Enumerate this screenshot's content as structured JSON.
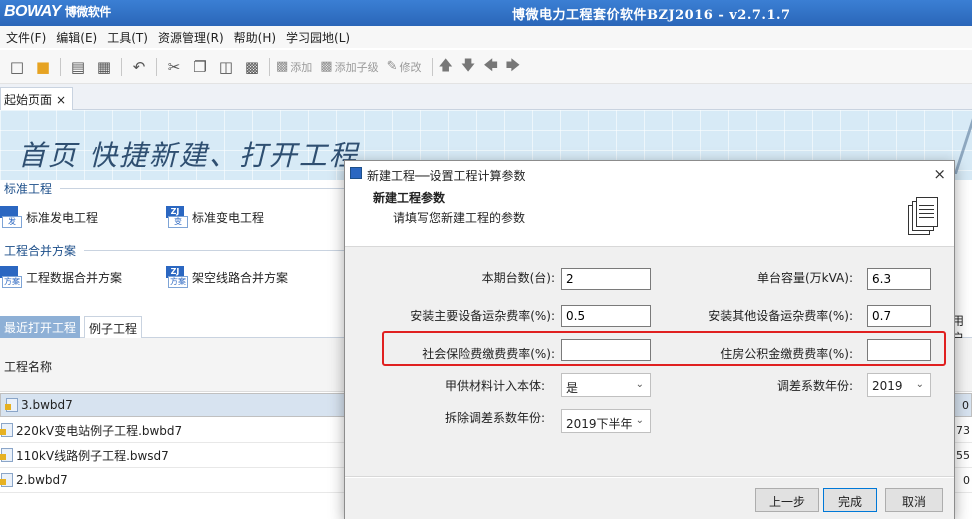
{
  "app": {
    "logo": "BOWAY",
    "logo_cn": "博微软件",
    "title": "博微电力工程套价软件BZJ2016 - v2.7.1.7"
  },
  "menu": [
    "文件(F)",
    "编辑(E)",
    "工具(T)",
    "资源管理(R)",
    "帮助(H)",
    "学习园地(L)"
  ],
  "toolbar": {
    "add": "添加",
    "add_child": "添加子级",
    "modify": "修改"
  },
  "tabs": {
    "start_page": "起始页面",
    "close": "×"
  },
  "banner": {
    "text": "首页  快捷新建、打开工程"
  },
  "standard_project": {
    "title": "标准工程",
    "items": [
      {
        "label": "标准发电工程",
        "icon_top": "",
        "icon_bottom": "发"
      },
      {
        "label": "标准变电工程",
        "icon_top": "ZJ",
        "icon_bottom": "变"
      }
    ]
  },
  "merge_scheme": {
    "title": "工程合并方案",
    "items": [
      {
        "label": "工程数据合并方案",
        "icon_top": "",
        "icon_bottom": "方案"
      },
      {
        "label": "架空线路合并方案",
        "icon_top": "ZJ",
        "icon_bottom": "方案"
      }
    ]
  },
  "recent": {
    "tab_recent": "最近打开工程",
    "tab_examples": "例子工程",
    "col_name": "工程名称",
    "edge_header": "用户",
    "rows": [
      {
        "name": "3.bwbd7",
        "value": "0"
      },
      {
        "name": "220kV变电站例子工程.bwbd7",
        "value": "73"
      },
      {
        "name": "110kV线路例子工程.bwsd7",
        "value": "55"
      },
      {
        "name": "2.bwbd7",
        "value": "0"
      }
    ]
  },
  "dialog": {
    "title": "新建工程──设置工程计算参数",
    "close": "×",
    "heading": "新建工程参数",
    "subheading": "请填写您新建工程的参数",
    "fields": {
      "units_label": "本期台数(台):",
      "units_value": "2",
      "capacity_label": "单台容量(万kVA):",
      "capacity_value": "6.3",
      "main_freight_label": "安装主要设备运杂费率(%):",
      "main_freight_value": "0.5",
      "other_freight_label": "安装其他设备运杂费率(%):",
      "other_freight_value": "0.7",
      "social_insurance_label": "社会保险费缴费费率(%):",
      "social_insurance_value": "",
      "housing_fund_label": "住房公积金缴费费率(%):",
      "housing_fund_value": "",
      "supplied_material_label": "甲供材料计入本体:",
      "supplied_material_value": "是",
      "adjust_year_label": "调差系数年份:",
      "adjust_year_value": "2019",
      "demolition_year_label": "拆除调差系数年份:",
      "demolition_year_value": "2019下半年"
    },
    "buttons": {
      "prev": "上一步",
      "finish": "完成",
      "cancel": "取消"
    }
  },
  "colors": {
    "titlebar": "#2a66b8",
    "highlight": "#e02020",
    "accent": "#2b67c1"
  },
  "icons": [
    "new-file-icon",
    "open-folder-icon",
    "save-icon",
    "save-all-icon",
    "undo-icon",
    "cut-icon",
    "copy-icon",
    "paste-icon",
    "delete-icon",
    "add-icon",
    "add-child-icon",
    "modify-icon",
    "arrow-up-icon",
    "arrow-down-icon",
    "arrow-left-icon",
    "arrow-right-icon"
  ]
}
